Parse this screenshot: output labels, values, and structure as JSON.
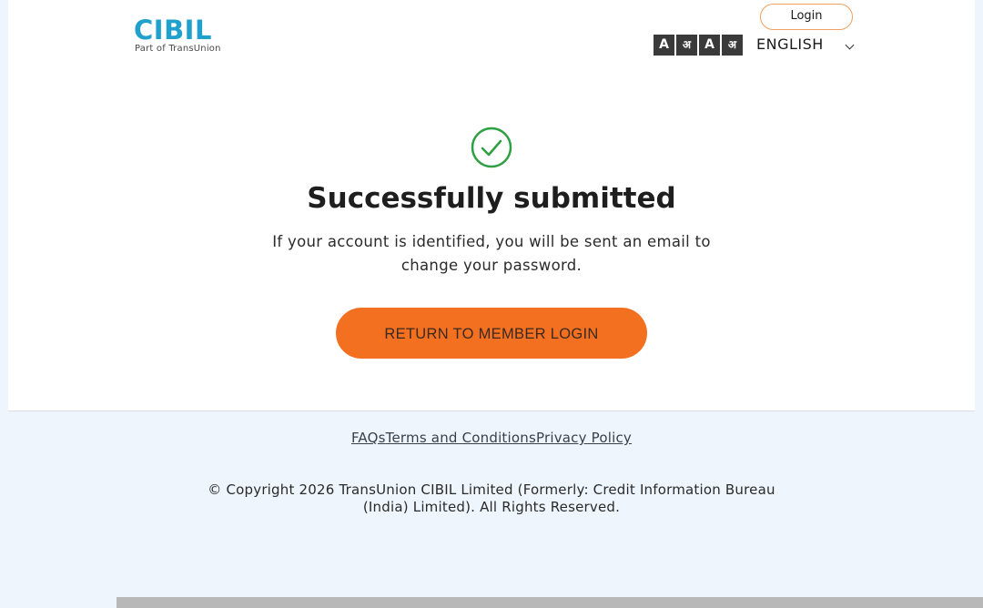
{
  "header": {
    "logo_text": "CIBIL",
    "logo_subtext": "Part of TransUnion",
    "login_label": "Login",
    "font_tools": [
      "A",
      "अ",
      "A",
      "अ"
    ],
    "language": "ENGLISH"
  },
  "main": {
    "title": "Successfully submitted",
    "message": "If your account is identified, you will be sent an email to change your password.",
    "return_button": "RETURN TO MEMBER LOGIN"
  },
  "footer": {
    "links": [
      "FAQs",
      "Terms and Conditions",
      "Privacy Policy"
    ],
    "copyright": "© Copyright 2026 TransUnion CIBIL Limited (Formerly: Credit Information Bureau (India) Limited). All Rights Reserved."
  },
  "colors": {
    "accent": "#f37021",
    "brand": "#1fa0cd",
    "success": "#2ea043"
  }
}
